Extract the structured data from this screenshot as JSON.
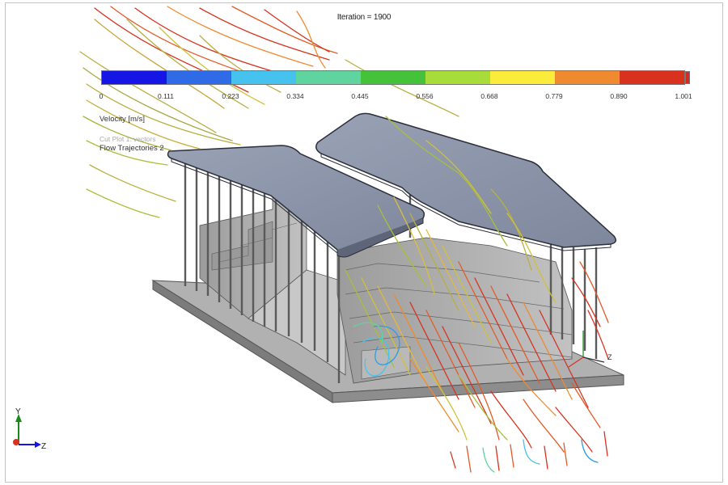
{
  "header": {
    "iteration_label": "Iteration = 1900"
  },
  "legend": {
    "title": "Velocity [m/s]",
    "subtitle": "Cut Plot 1: vectors",
    "item": "Flow Trajectories 2",
    "ticks": [
      "0",
      "0.111",
      "0.223",
      "0.334",
      "0.445",
      "0.556",
      "0.668",
      "0.779",
      "0.890",
      "1.001"
    ],
    "colors": [
      "#1515e6",
      "#2f6be6",
      "#45c3ee",
      "#5fd49e",
      "#44c23a",
      "#a7dc3a",
      "#fbeb3a",
      "#f08a2e",
      "#d8321f"
    ]
  },
  "axes": {
    "y_label": "Y",
    "z_label": "Z",
    "model_z_label": "Z"
  },
  "colors": {
    "roof": "#8e96ac",
    "roof_edge": "#2b2f3a",
    "wall": "#a8a8a8",
    "base_top": "#b1b1b1",
    "base_side": "#7c7c7c"
  }
}
